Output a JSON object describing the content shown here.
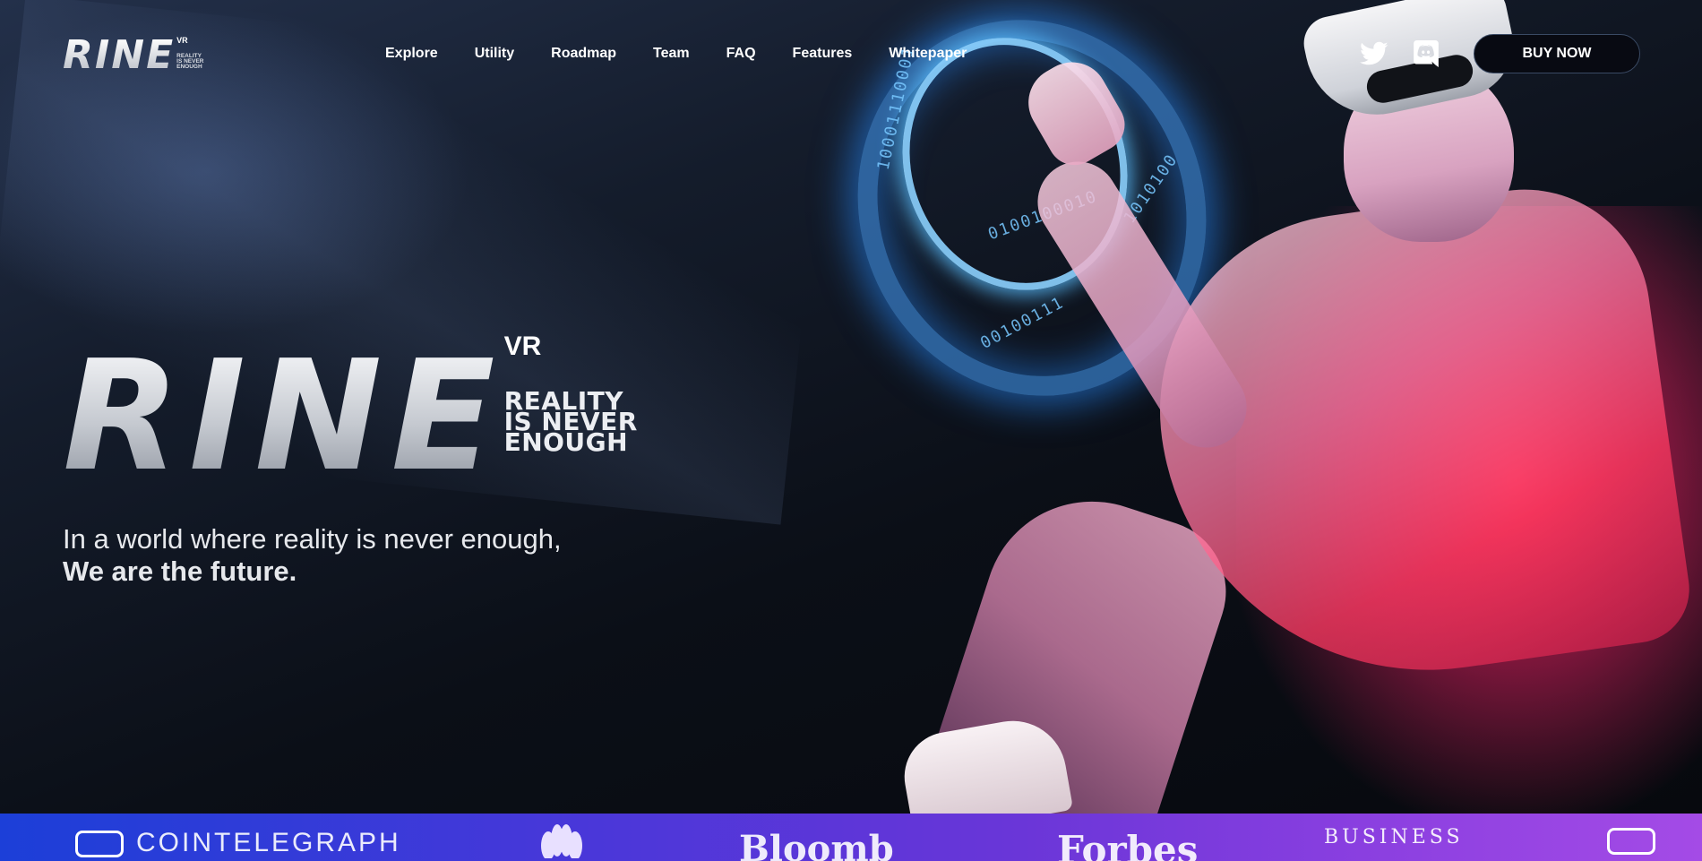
{
  "header": {
    "logo": {
      "word": "RINE",
      "superscript": "VR",
      "tagline_lines": [
        "REALITY",
        "IS NEVER",
        "ENOUGH"
      ]
    },
    "nav": [
      "Explore",
      "Utility",
      "Roadmap",
      "Team",
      "FAQ",
      "Features",
      "Whitepaper"
    ],
    "social": [
      "twitter-icon",
      "discord-icon"
    ],
    "cta": "BUY NOW"
  },
  "hero": {
    "logo": {
      "word": "RINE",
      "superscript": "VR",
      "tagline_lines": [
        "REALITY",
        "IS NEVER",
        "ENOUGH"
      ]
    },
    "line1": "In a world where reality is never enough,",
    "line2": "We are the future.",
    "binary": [
      "10001110001",
      "0100100010",
      "00100111",
      "1010100"
    ]
  },
  "press": [
    "COINTELEGRAPH",
    "Bloomb",
    "Forbes",
    "BUSINESS"
  ],
  "colors": {
    "background": "#0c1018",
    "press_start": "#1c3fd8",
    "press_end": "#a44be6",
    "accent_glow": "#46a0ff",
    "pink_glow": "#ff2850"
  }
}
